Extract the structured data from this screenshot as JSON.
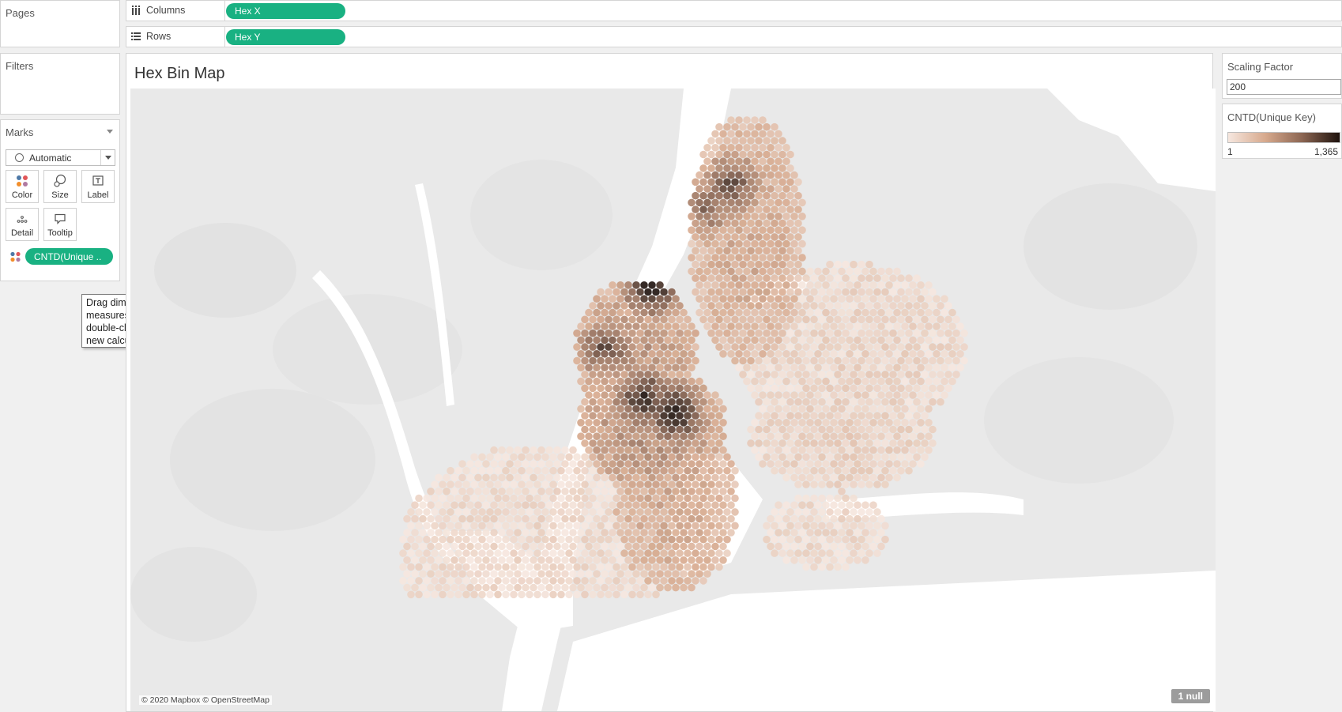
{
  "pages": {
    "label": "Pages"
  },
  "filters": {
    "label": "Filters"
  },
  "marks": {
    "label": "Marks",
    "mark_type": "Automatic",
    "buttons": {
      "color": "Color",
      "size": "Size",
      "label": "Label",
      "detail": "Detail",
      "tooltip": "Tooltip"
    },
    "pill": "CNTD(Unique ..",
    "drop_hint": "Drag dimensions or measures here or double-click to start a new calculation."
  },
  "shelves": {
    "columns": {
      "label": "Columns",
      "pill": "Hex X"
    },
    "rows": {
      "label": "Rows",
      "pill": "Hex Y"
    }
  },
  "view": {
    "title": "Hex Bin Map",
    "attribution": "© 2020 Mapbox © OpenStreetMap",
    "null_indicator": "1 null"
  },
  "parameter": {
    "label": "Scaling Factor",
    "value": "200"
  },
  "legend": {
    "title": "CNTD(Unique Key)",
    "min_label": "1",
    "max_label": "1,365",
    "ramp_colors": [
      "#f6e7df",
      "#d7a98d",
      "#8b6552",
      "#1e120d"
    ]
  },
  "colors": {
    "pill": "#19b182",
    "land": "#e9e9e9",
    "water": "#ffffff"
  },
  "icons": {
    "columns": "columns-icon",
    "rows": "rows-icon",
    "color": "color-dots-icon",
    "size": "size-icon",
    "label": "label-icon",
    "detail": "detail-icon",
    "tooltip": "tooltip-icon"
  }
}
